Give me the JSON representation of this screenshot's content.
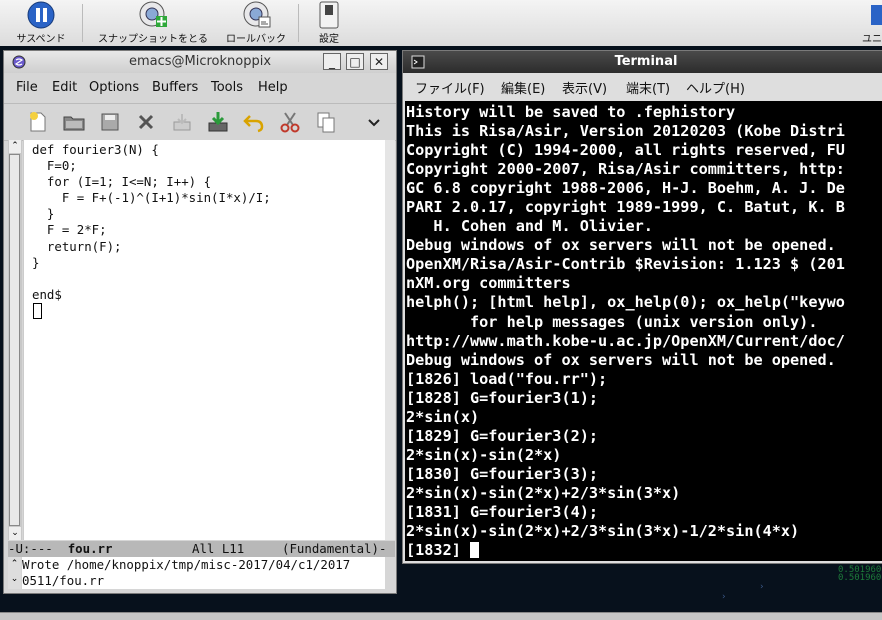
{
  "vbox_toolbar": {
    "buttons": [
      {
        "label": "サスペンド",
        "icon": "pause-icon"
      },
      {
        "label": "スナップショットをとる",
        "icon": "snapshot-camera-icon"
      },
      {
        "label": "ロールバック",
        "icon": "rollback-icon"
      },
      {
        "label": "設定",
        "icon": "settings-switch-icon"
      },
      {
        "label": "ユニ",
        "icon": "unity-icon"
      }
    ]
  },
  "emacs": {
    "title": "emacs@Microknoppix",
    "menu": [
      "File",
      "Edit",
      "Options",
      "Buffers",
      "Tools",
      "Help"
    ],
    "toolbar_icons": [
      "new-file-icon",
      "open-folder-icon",
      "save-icon",
      "close-x-icon",
      "save-as-icon",
      "download-icon",
      "undo-icon",
      "cut-scissors-icon",
      "copy-icon",
      "chevron-down-icon"
    ],
    "code_lines": [
      "def fourier3(N) {",
      "  F=0;",
      "  for (I=1; I<=N; I++) {",
      "    F = F+(-1)^(I+1)*sin(I*x)/I;",
      "  }",
      "  F = 2*F;",
      "  return(F);",
      "}",
      "",
      "end$"
    ],
    "modeline": {
      "status": "-U:---  ",
      "buffer": "fou.rr",
      "position": "All L11",
      "mode": "(Fundamental)-"
    },
    "echo_lines": [
      "Wrote /home/knoppix/tmp/misc-2017/04/c1/2017",
      "0511/fou.rr"
    ]
  },
  "terminal": {
    "title": "Terminal",
    "menu": [
      "ファイル(F)",
      "編集(E)",
      "表示(V)",
      "端末(T)",
      "ヘルプ(H)"
    ],
    "lines": [
      "History will be saved to .fephistory",
      "This is Risa/Asir, Version 20120203 (Kobe Distri",
      "Copyright (C) 1994-2000, all rights reserved, FU",
      "Copyright 2000-2007, Risa/Asir committers, http:",
      "GC 6.8 copyright 1988-2006, H-J. Boehm, A. J. De",
      "PARI 2.0.17, copyright 1989-1999, C. Batut, K. B",
      "   H. Cohen and M. Olivier.",
      "Debug windows of ox servers will not be opened.",
      "OpenXM/Risa/Asir-Contrib $Revision: 1.123 $ (201",
      "nXM.org committers",
      "helph(); [html help], ox_help(0); ox_help(\"keywo",
      "       for help messages (unix version only).",
      "http://www.math.kobe-u.ac.jp/OpenXM/Current/doc/",
      "Debug windows of ox servers will not be opened.",
      "[1826] load(\"fou.rr\");",
      "[1828] G=fourier3(1);",
      "2*sin(x)",
      "[1829] G=fourier3(2);",
      "2*sin(x)-sin(2*x)",
      "[1830] G=fourier3(3);",
      "2*sin(x)-sin(2*x)+2/3*sin(3*x)",
      "[1831] G=fourier3(4);",
      "2*sin(x)-sin(2*x)+2/3*sin(3*x)-1/2*sin(4*x)"
    ],
    "prompt": "[1832] "
  },
  "desktop": {
    "numbers": [
      "0.5019600",
      "0.5019600"
    ]
  }
}
